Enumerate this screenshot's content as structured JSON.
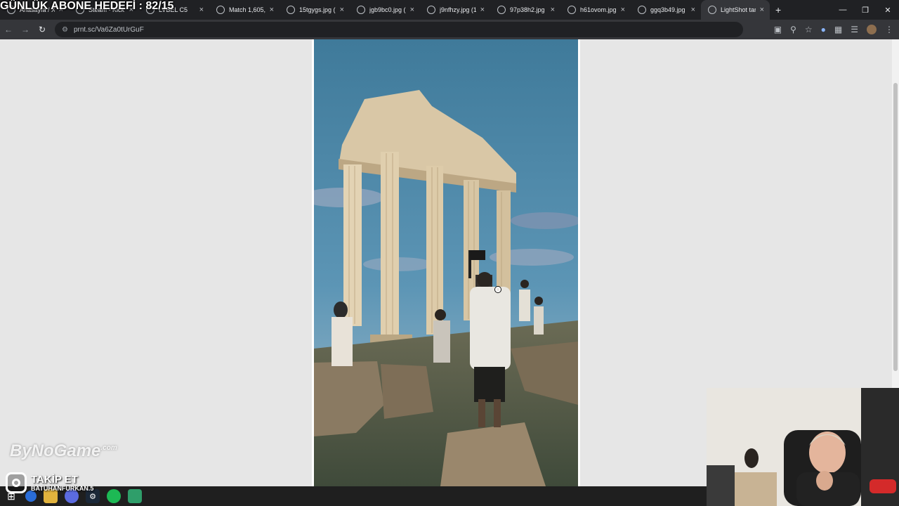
{
  "overlay": {
    "title": "GÜNLÜK ABONE HEDEFİ : 82/15",
    "watermark": "ByNoGame",
    "watermark_suffix": ".com",
    "follow_label": "TAKİP ET",
    "handle": "BATUHANFURKAN.5"
  },
  "browser": {
    "tabs": [
      {
        "title": "Anasayfa / X",
        "active": false
      },
      {
        "title": "Steam - Kick",
        "active": false
      },
      {
        "title": "LVBEL C5",
        "active": false
      },
      {
        "title": "Match 1,605,0",
        "active": false
      },
      {
        "title": "15tgygs.jpg (1",
        "active": false
      },
      {
        "title": "jgb9bc0.jpg (1",
        "active": false
      },
      {
        "title": "j9nfhzy.jpg (1",
        "active": false
      },
      {
        "title": "97p38h2.jpg (1",
        "active": false
      },
      {
        "title": "h61ovom.jpg (",
        "active": false
      },
      {
        "title": "ggq3b49.jpg (",
        "active": false
      },
      {
        "title": "LightShot tara",
        "active": true
      }
    ],
    "url": "prnt.sc/Va6Za0tUrGuF",
    "new_tab_glyph": "+",
    "close_glyph": "×"
  },
  "icons": {
    "back": "back-arrow-icon",
    "forward": "forward-arrow-icon",
    "reload": "reload-icon",
    "site_info": "tune-icon",
    "install": "install-app-icon",
    "zoom": "zoom-icon",
    "bookmark": "star-icon",
    "extensions": "puzzle-icon"
  },
  "colors": {
    "tab_bg": "#202124",
    "toolbar_bg": "#35363a",
    "page_bg": "#e6e6e6"
  }
}
